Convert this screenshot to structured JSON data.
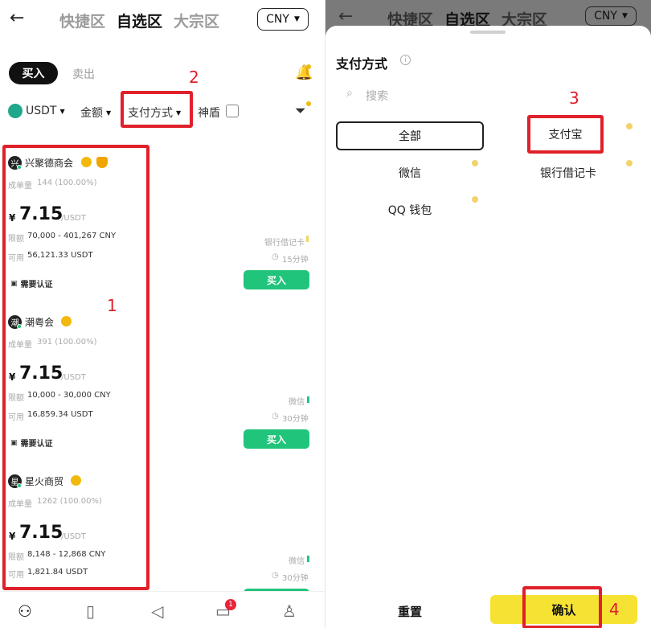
{
  "header": {
    "tabs": [
      "快捷区",
      "自选区",
      "大宗区"
    ],
    "active_tab": "自选区",
    "currency": "CNY"
  },
  "trade_tabs": {
    "buy": "买入",
    "sell": "卖出"
  },
  "filters": {
    "coin": "USDT",
    "amount": "金额",
    "payment": "支付方式",
    "shield": "神盾"
  },
  "ads": [
    {
      "merchant": "兴聚德商会",
      "avatar_char": "兴",
      "orders_label": "成单量",
      "orders": "144 (100.00%)",
      "currency_symbol": "¥",
      "price": "7.15",
      "unit": "/USDT",
      "limit_label": "限额",
      "limit": "70,000 - 401,267 CNY",
      "avail_label": "可用",
      "available": "56,121.33 USDT",
      "verify": "需要认证",
      "payment": "银行借记卡",
      "time": "15分钟",
      "button": "买入"
    },
    {
      "merchant": "潮粤会",
      "avatar_char": "潮",
      "orders_label": "成单量",
      "orders": "391 (100.00%)",
      "currency_symbol": "¥",
      "price": "7.15",
      "unit": "/USDT",
      "limit_label": "限额",
      "limit": "10,000 - 30,000 CNY",
      "avail_label": "可用",
      "available": "16,859.34 USDT",
      "verify": "需要认证",
      "payment": "微信",
      "time": "30分钟",
      "button": "买入"
    },
    {
      "merchant": "星火商贸",
      "avatar_char": "星",
      "orders_label": "成单量",
      "orders": "1262 (100.00%)",
      "currency_symbol": "¥",
      "price": "7.15",
      "unit": "/USDT",
      "limit_label": "限额",
      "limit": "8,148 - 12,868 CNY",
      "avail_label": "可用",
      "available": "1,821.84 USDT",
      "payment": "微信",
      "time": "30分钟",
      "button": "买入"
    }
  ],
  "nav": {
    "messages_badge": "1"
  },
  "annotations": [
    "1",
    "2",
    "3",
    "4"
  ],
  "sheet": {
    "title": "支付方式",
    "search_placeholder": "搜索",
    "options": [
      "全部",
      "支付宝",
      "微信",
      "银行借记卡",
      "QQ 钱包"
    ],
    "reset": "重置",
    "confirm": "确认"
  },
  "colors": {
    "annotation_red": "#e0202a",
    "buy_green": "#21c47b",
    "confirm_yellow": "#f6e233"
  }
}
